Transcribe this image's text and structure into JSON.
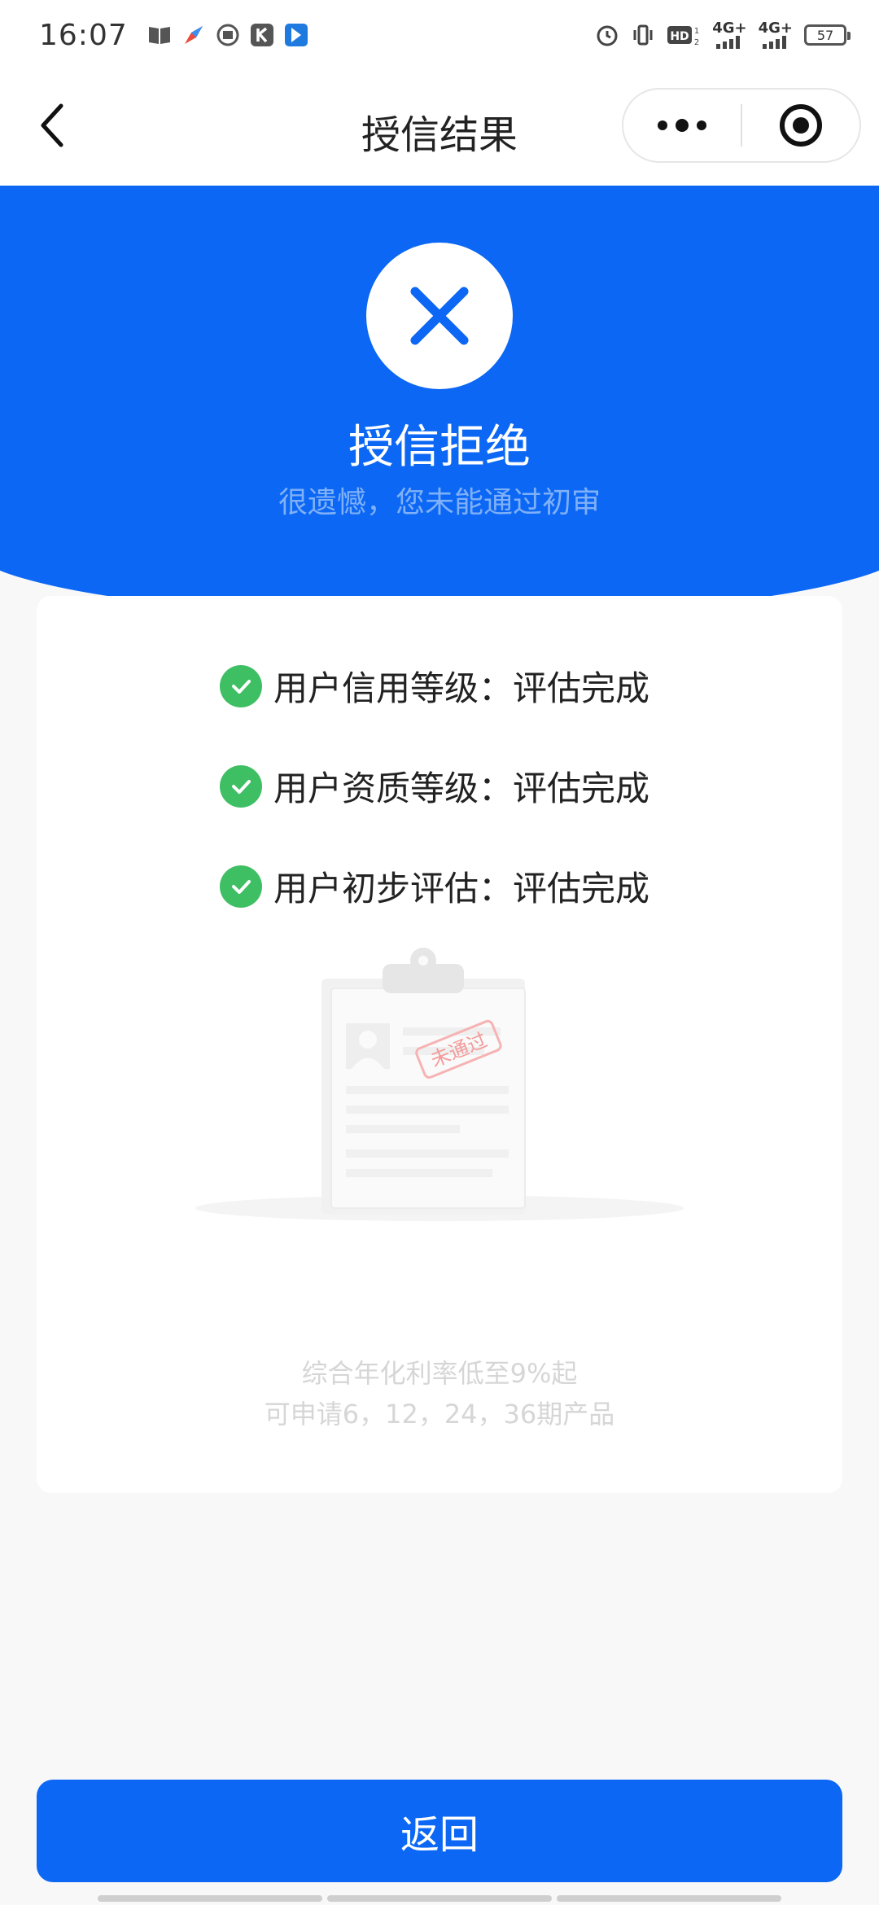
{
  "status_bar": {
    "time": "16:07",
    "icons_left": [
      "book-icon",
      "compass-icon",
      "radio-icon",
      "k-app-icon",
      "bookmark-app-icon"
    ],
    "icons_right": [
      "alarm-icon",
      "vibrate-icon",
      "hd-icon",
      "signal-4g-icon",
      "signal-4g-icon"
    ],
    "network_label_1": "4G+",
    "network_label_2": "4G+",
    "battery": "57"
  },
  "nav": {
    "title": "授信结果"
  },
  "hero": {
    "title": "授信拒绝",
    "subtitle": "很遗憾，您未能通过初审"
  },
  "checks": [
    {
      "label": "用户信用等级：评估完成"
    },
    {
      "label": "用户资质等级：评估完成"
    },
    {
      "label": "用户初步评估：评估完成"
    }
  ],
  "illustration": {
    "stamp": "未通过"
  },
  "footnote": {
    "line1": "综合年化利率低至9%起",
    "line2": "可申请6，12，24，36期产品"
  },
  "button": {
    "label": "返回"
  },
  "colors": {
    "brand_blue": "#0b67f4",
    "success_green": "#3fbf64"
  }
}
